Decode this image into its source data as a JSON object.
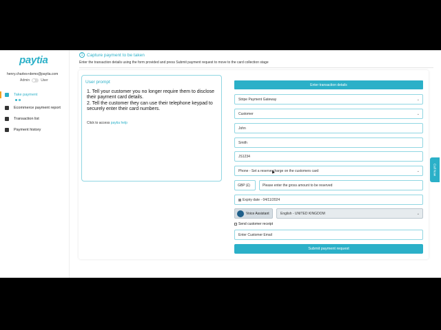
{
  "sidebar": {
    "logo_text": "paytia",
    "user_email": "henry.charles+demo@paytia.com",
    "role_left": "Admin",
    "role_right": "User",
    "items": [
      {
        "label": "Take payment",
        "icon": "cart-icon",
        "active": true
      },
      {
        "label": "Ecommerce payment report",
        "icon": "document-icon"
      },
      {
        "label": "Transaction list",
        "icon": "document-icon"
      },
      {
        "label": "Payment history",
        "icon": "document-icon"
      }
    ]
  },
  "main": {
    "step_number": "1",
    "step_title": "Capture payment to be taken",
    "step_description": "Enter the transaction details using the form provided and press Submit payment request to move to the card collection stage"
  },
  "prompt": {
    "title": "User prompt",
    "line1": "1. Tell your customer you no longer require them to disclose their payment card details.",
    "line2": "2. Tell the customer they can use their telephone keypad to securely enter their card numbers.",
    "help_prefix": "Click to access ",
    "help_link": "paytia help"
  },
  "form": {
    "header": "Enter transaction details",
    "gateway": "Stripe Payment Gateway",
    "customer_type": "Customer",
    "first_name": "John",
    "last_name": "Smith",
    "reference": "JS1234",
    "payment_type": "Phone - Set a reserve charge on the customers card",
    "currency": "GBP (£)",
    "amount_placeholder": "Please enter the gross amount to be reserved",
    "expiry_label": "Expiry date -",
    "expiry_value": "04/11/2024",
    "voice_assistant": "Voice Assistant",
    "language": "English - UNITED KINGDOM",
    "send_receipt": "Send customer receipt",
    "email_placeholder": "Enter Customer Email",
    "submit": "Submit payment request"
  },
  "call_now": "Call Now",
  "colors": {
    "accent": "#2bb0c8",
    "active_marker": "#f0a020"
  }
}
